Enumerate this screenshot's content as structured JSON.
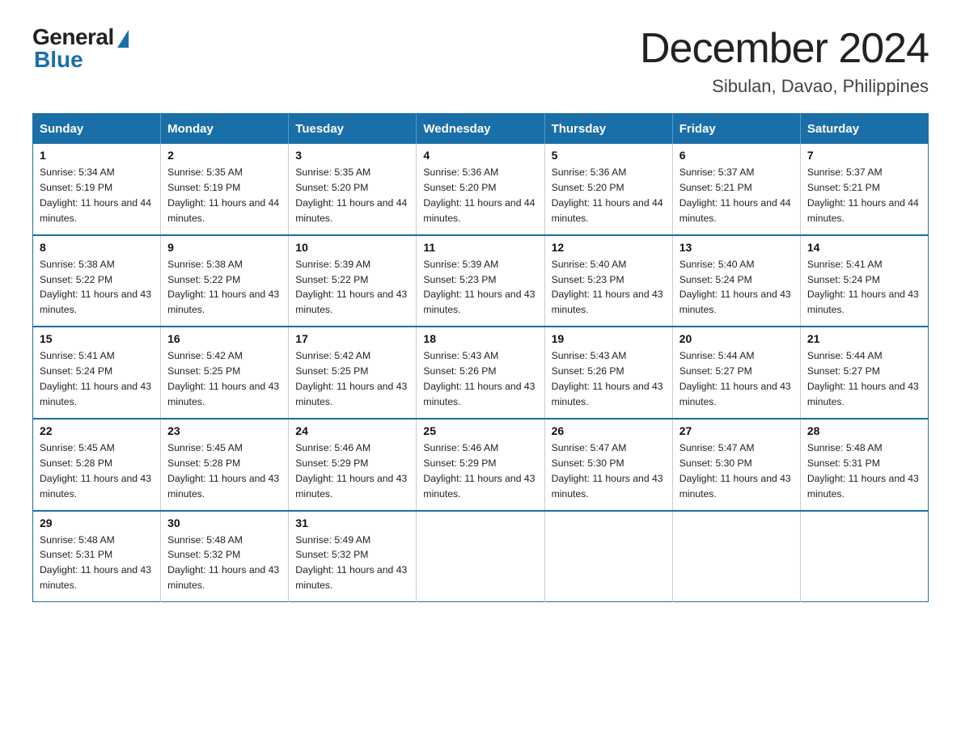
{
  "header": {
    "logo_general": "General",
    "logo_blue": "Blue",
    "month_title": "December 2024",
    "location": "Sibulan, Davao, Philippines"
  },
  "calendar": {
    "days_of_week": [
      "Sunday",
      "Monday",
      "Tuesday",
      "Wednesday",
      "Thursday",
      "Friday",
      "Saturday"
    ],
    "weeks": [
      [
        {
          "day": "1",
          "sunrise": "5:34 AM",
          "sunset": "5:19 PM",
          "daylight": "11 hours and 44 minutes."
        },
        {
          "day": "2",
          "sunrise": "5:35 AM",
          "sunset": "5:19 PM",
          "daylight": "11 hours and 44 minutes."
        },
        {
          "day": "3",
          "sunrise": "5:35 AM",
          "sunset": "5:20 PM",
          "daylight": "11 hours and 44 minutes."
        },
        {
          "day": "4",
          "sunrise": "5:36 AM",
          "sunset": "5:20 PM",
          "daylight": "11 hours and 44 minutes."
        },
        {
          "day": "5",
          "sunrise": "5:36 AM",
          "sunset": "5:20 PM",
          "daylight": "11 hours and 44 minutes."
        },
        {
          "day": "6",
          "sunrise": "5:37 AM",
          "sunset": "5:21 PM",
          "daylight": "11 hours and 44 minutes."
        },
        {
          "day": "7",
          "sunrise": "5:37 AM",
          "sunset": "5:21 PM",
          "daylight": "11 hours and 44 minutes."
        }
      ],
      [
        {
          "day": "8",
          "sunrise": "5:38 AM",
          "sunset": "5:22 PM",
          "daylight": "11 hours and 43 minutes."
        },
        {
          "day": "9",
          "sunrise": "5:38 AM",
          "sunset": "5:22 PM",
          "daylight": "11 hours and 43 minutes."
        },
        {
          "day": "10",
          "sunrise": "5:39 AM",
          "sunset": "5:22 PM",
          "daylight": "11 hours and 43 minutes."
        },
        {
          "day": "11",
          "sunrise": "5:39 AM",
          "sunset": "5:23 PM",
          "daylight": "11 hours and 43 minutes."
        },
        {
          "day": "12",
          "sunrise": "5:40 AM",
          "sunset": "5:23 PM",
          "daylight": "11 hours and 43 minutes."
        },
        {
          "day": "13",
          "sunrise": "5:40 AM",
          "sunset": "5:24 PM",
          "daylight": "11 hours and 43 minutes."
        },
        {
          "day": "14",
          "sunrise": "5:41 AM",
          "sunset": "5:24 PM",
          "daylight": "11 hours and 43 minutes."
        }
      ],
      [
        {
          "day": "15",
          "sunrise": "5:41 AM",
          "sunset": "5:24 PM",
          "daylight": "11 hours and 43 minutes."
        },
        {
          "day": "16",
          "sunrise": "5:42 AM",
          "sunset": "5:25 PM",
          "daylight": "11 hours and 43 minutes."
        },
        {
          "day": "17",
          "sunrise": "5:42 AM",
          "sunset": "5:25 PM",
          "daylight": "11 hours and 43 minutes."
        },
        {
          "day": "18",
          "sunrise": "5:43 AM",
          "sunset": "5:26 PM",
          "daylight": "11 hours and 43 minutes."
        },
        {
          "day": "19",
          "sunrise": "5:43 AM",
          "sunset": "5:26 PM",
          "daylight": "11 hours and 43 minutes."
        },
        {
          "day": "20",
          "sunrise": "5:44 AM",
          "sunset": "5:27 PM",
          "daylight": "11 hours and 43 minutes."
        },
        {
          "day": "21",
          "sunrise": "5:44 AM",
          "sunset": "5:27 PM",
          "daylight": "11 hours and 43 minutes."
        }
      ],
      [
        {
          "day": "22",
          "sunrise": "5:45 AM",
          "sunset": "5:28 PM",
          "daylight": "11 hours and 43 minutes."
        },
        {
          "day": "23",
          "sunrise": "5:45 AM",
          "sunset": "5:28 PM",
          "daylight": "11 hours and 43 minutes."
        },
        {
          "day": "24",
          "sunrise": "5:46 AM",
          "sunset": "5:29 PM",
          "daylight": "11 hours and 43 minutes."
        },
        {
          "day": "25",
          "sunrise": "5:46 AM",
          "sunset": "5:29 PM",
          "daylight": "11 hours and 43 minutes."
        },
        {
          "day": "26",
          "sunrise": "5:47 AM",
          "sunset": "5:30 PM",
          "daylight": "11 hours and 43 minutes."
        },
        {
          "day": "27",
          "sunrise": "5:47 AM",
          "sunset": "5:30 PM",
          "daylight": "11 hours and 43 minutes."
        },
        {
          "day": "28",
          "sunrise": "5:48 AM",
          "sunset": "5:31 PM",
          "daylight": "11 hours and 43 minutes."
        }
      ],
      [
        {
          "day": "29",
          "sunrise": "5:48 AM",
          "sunset": "5:31 PM",
          "daylight": "11 hours and 43 minutes."
        },
        {
          "day": "30",
          "sunrise": "5:48 AM",
          "sunset": "5:32 PM",
          "daylight": "11 hours and 43 minutes."
        },
        {
          "day": "31",
          "sunrise": "5:49 AM",
          "sunset": "5:32 PM",
          "daylight": "11 hours and 43 minutes."
        },
        null,
        null,
        null,
        null
      ]
    ]
  }
}
